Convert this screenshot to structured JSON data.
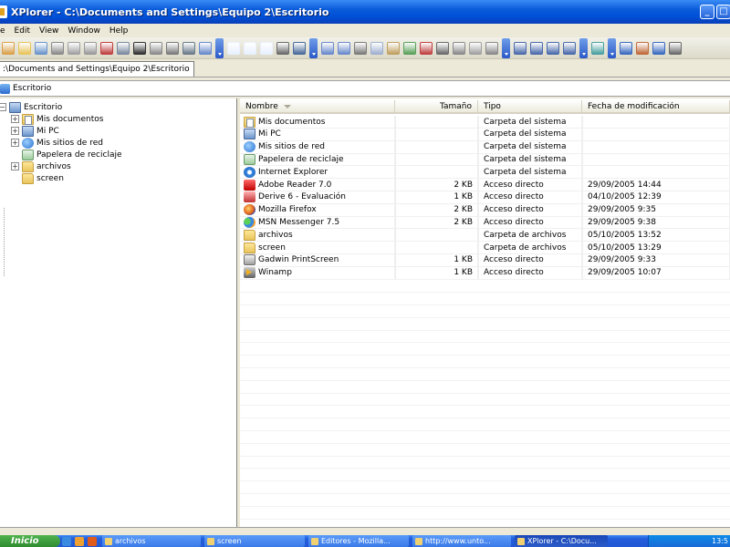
{
  "window": {
    "title": "XPlorer - C:\\Documents and Settings\\Equipo 2\\Escritorio"
  },
  "menu": [
    "e",
    "Edit",
    "View",
    "Window",
    "Help"
  ],
  "tab": {
    "label": ":\\Documents and Settings\\Equipo 2\\Escritorio"
  },
  "address": {
    "label": "Escritorio"
  },
  "tree": [
    {
      "label": "Escritorio",
      "icon": "desktop-icon",
      "expander": "−",
      "level": 0
    },
    {
      "label": "Mis documentos",
      "icon": "mydocs",
      "expander": "+",
      "level": 1
    },
    {
      "label": "Mi PC",
      "icon": "pc",
      "expander": "+",
      "level": 1
    },
    {
      "label": "Mis sitios de red",
      "icon": "net",
      "expander": "+",
      "level": 1
    },
    {
      "label": "Papelera de reciclaje",
      "icon": "recycle",
      "expander": "",
      "level": 1
    },
    {
      "label": "archivos",
      "icon": "folder",
      "expander": "+",
      "level": 1
    },
    {
      "label": "screen",
      "icon": "folder",
      "expander": "",
      "level": 1
    }
  ],
  "columns": {
    "name": "Nombre",
    "size": "Tamaño",
    "type": "Tipo",
    "date": "Fecha de modificación"
  },
  "files": [
    {
      "name": "Mis documentos",
      "size": "",
      "type": "Carpeta del sistema",
      "date": "",
      "icon": "mydocs"
    },
    {
      "name": "Mi PC",
      "size": "",
      "type": "Carpeta del sistema",
      "date": "",
      "icon": "pc"
    },
    {
      "name": "Mis sitios de red",
      "size": "",
      "type": "Carpeta del sistema",
      "date": "",
      "icon": "net"
    },
    {
      "name": "Papelera de reciclaje",
      "size": "",
      "type": "Carpeta del sistema",
      "date": "",
      "icon": "recycle"
    },
    {
      "name": "Internet Explorer",
      "size": "",
      "type": "Carpeta del sistema",
      "date": "",
      "icon": "ie"
    },
    {
      "name": "Adobe Reader 7.0",
      "size": "2 KB",
      "type": "Acceso directo",
      "date": "29/09/2005 14:44",
      "icon": "pdf"
    },
    {
      "name": "Derive 6 - Evaluación",
      "size": "1 KB",
      "type": "Acceso directo",
      "date": "04/10/2005 12:39",
      "icon": "derive"
    },
    {
      "name": "Mozilla Firefox",
      "size": "2 KB",
      "type": "Acceso directo",
      "date": "29/09/2005 9:35",
      "icon": "firefox"
    },
    {
      "name": "MSN Messenger 7.5",
      "size": "2 KB",
      "type": "Acceso directo",
      "date": "29/09/2005 9:38",
      "icon": "msn"
    },
    {
      "name": "archivos",
      "size": "",
      "type": "Carpeta de archivos",
      "date": "05/10/2005 13:52",
      "icon": "folder"
    },
    {
      "name": "screen",
      "size": "",
      "type": "Carpeta de archivos",
      "date": "05/10/2005 13:29",
      "icon": "folder"
    },
    {
      "name": "Gadwin PrintScreen",
      "size": "1 KB",
      "type": "Acceso directo",
      "date": "29/09/2005 9:33",
      "icon": "print"
    },
    {
      "name": "Winamp",
      "size": "1 KB",
      "type": "Acceso directo",
      "date": "29/09/2005 10:07",
      "icon": "winamp"
    }
  ],
  "taskbar": {
    "start": "Inicio",
    "tasks": [
      "archivos",
      "screen",
      "Editores - Mozilla...",
      "http://www.unto...",
      "XPlorer - C:\\Docu..."
    ],
    "clock": "13:5"
  },
  "colors": {
    "title_bar": "#0a5bd9",
    "taskbar": "#245edb",
    "start_button": "#2f8c2f"
  }
}
